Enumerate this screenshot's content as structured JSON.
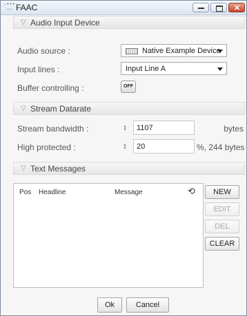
{
  "window": {
    "title": "FAAC",
    "app_icon_text": "-⁴⁴⁴\n◦◦",
    "controls": {
      "minimize": "—",
      "maximize": "□",
      "close": "✕"
    }
  },
  "sections": {
    "audio_input": "Audio Input Device",
    "stream_datarate": "Stream Datarate",
    "text_messages": "Text Messages"
  },
  "audio": {
    "source_label": "Audio source :",
    "source_value": "Native Example Device",
    "source_icon": "audio-device-icon",
    "lines_label": "Input lines :",
    "lines_value": "Input Line A",
    "buffer_label": "Buffer controlling :",
    "buffer_button": "OFF"
  },
  "stream": {
    "bandwidth_label": "Stream bandwidth :",
    "bandwidth_value": "1107",
    "bandwidth_unit": "bytes",
    "protected_label": "High protected :",
    "protected_value": "20",
    "protected_unit": "%, 244 bytes",
    "spinner_icon": "spinner-icon"
  },
  "messages": {
    "columns": {
      "pos": "Pos",
      "headline": "Headline",
      "message": "Message"
    },
    "refresh_icon": "refresh-icon",
    "buttons": {
      "new": "NEW",
      "edit": "EDIT",
      "del": "DEL",
      "clear": "CLEAR"
    }
  },
  "footer": {
    "ok": "Ok",
    "cancel": "Cancel"
  }
}
